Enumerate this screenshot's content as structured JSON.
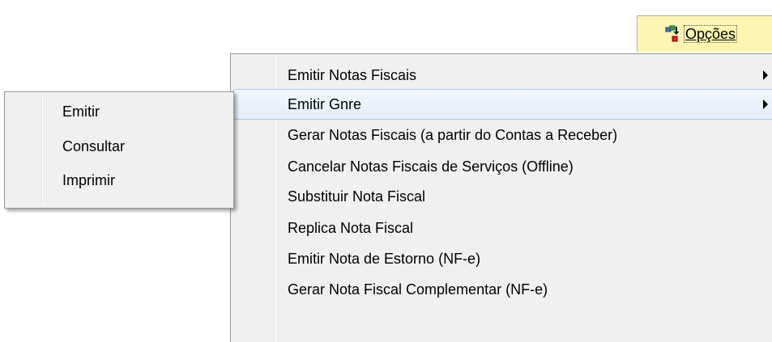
{
  "toolbar": {
    "options_label": "Opções",
    "options_icon": "options-icon"
  },
  "main_menu": {
    "items": [
      {
        "label": "Emitir Notas Fiscais",
        "has_submenu": true
      },
      {
        "label": "Emitir Gnre",
        "has_submenu": true,
        "highlighted": true
      },
      {
        "label": "Gerar Notas Fiscais (a partir do Contas a Receber)"
      },
      {
        "label": "Cancelar Notas Fiscais de Serviços (Offline)"
      },
      {
        "label": "Substituir Nota Fiscal"
      },
      {
        "label": "Replica Nota Fiscal"
      },
      {
        "label": "Emitir Nota de Estorno (NF-e)"
      },
      {
        "label": "Gerar Nota Fiscal Complementar (NF-e)"
      }
    ]
  },
  "sub_menu": {
    "items": [
      {
        "label": "Emitir"
      },
      {
        "label": "Consultar"
      },
      {
        "label": "Imprimir"
      }
    ]
  },
  "colors": {
    "button_background": "#fcf6b2",
    "menu_background": "#f0f0f0",
    "highlight_border": "#a8c8ec"
  }
}
